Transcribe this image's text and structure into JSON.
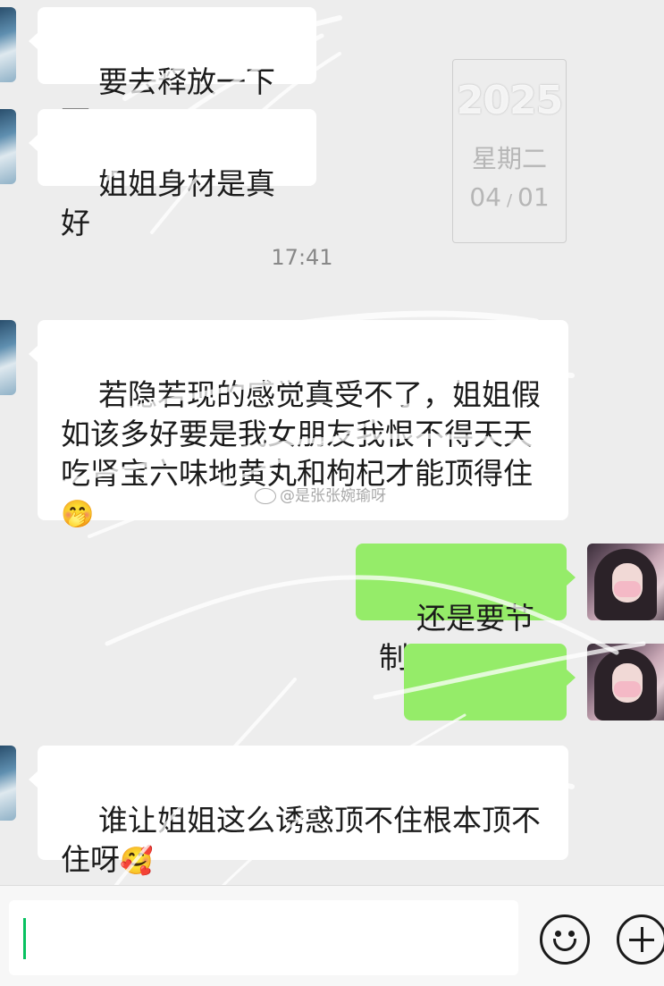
{
  "date_card": {
    "year": "2025",
    "weekday": "星期二",
    "month": "04",
    "day": "01"
  },
  "timestamp": "17:41",
  "watermark": "@是张张婉瑜呀",
  "messages": [
    {
      "side": "left",
      "text": "要去释放一下下"
    },
    {
      "side": "left",
      "text": "姐姐身材是真好"
    },
    {
      "side": "left",
      "text": "若隐若现的感觉真受不了，姐姐假如该多好要是我女朋友我恨不得天天吃肾宝六味地黄丸和枸杞才能顶得住",
      "emoji": "🤭"
    },
    {
      "side": "right",
      "text": "还是要节制"
    },
    {
      "side": "right",
      "text": "",
      "emoji": "🤭🤭🤭"
    },
    {
      "side": "left",
      "text": "谁让姐姐这么诱惑顶不住根本顶不住呀",
      "emoji": "🥰"
    }
  ],
  "input_bar": {
    "emoji_icon": "smile-face-icon",
    "plus_icon": "plus-circle-icon",
    "accent_color": "#07c160",
    "bubble_color": "#95ec69"
  }
}
